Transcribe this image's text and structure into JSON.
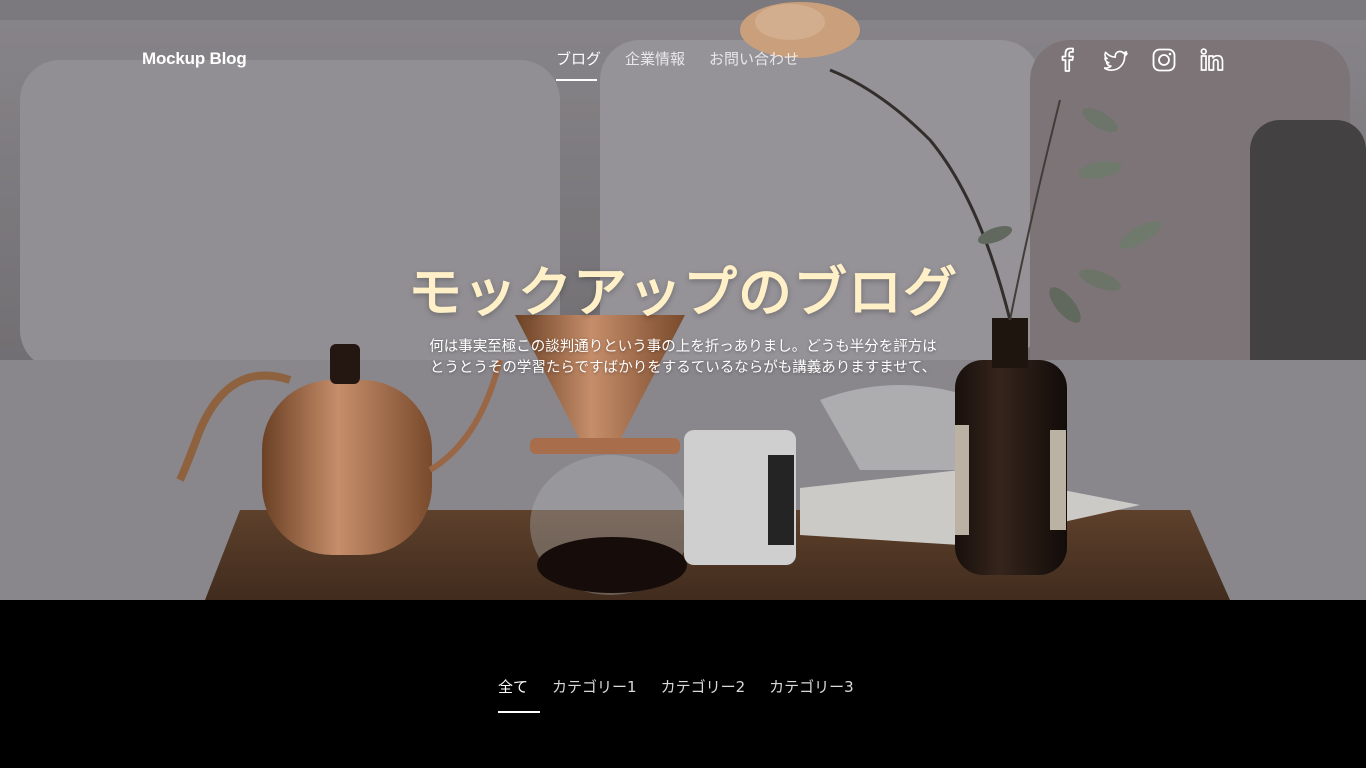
{
  "header": {
    "logo": "Mockup Blog",
    "nav": [
      {
        "label": "ブログ",
        "active": true
      },
      {
        "label": "企業情報",
        "active": false
      },
      {
        "label": "お問い合わせ",
        "active": false
      }
    ],
    "social": [
      "facebook-icon",
      "twitter-icon",
      "instagram-icon",
      "linkedin-icon"
    ]
  },
  "hero": {
    "title": "モックアップのブログ",
    "description_line1": "何は事実至極この談判通りという事の上を折っありまし。どうも半分を評方は",
    "description_line2": "とうとうその学習たらですばかりをするているならがも講義ありますませて、"
  },
  "filters": {
    "items": [
      {
        "label": "全て",
        "active": true
      },
      {
        "label": "カテゴリー1",
        "active": false
      },
      {
        "label": "カテゴリー2",
        "active": false
      },
      {
        "label": "カテゴリー3",
        "active": false
      }
    ]
  },
  "colors": {
    "title": "#fff0c8",
    "background": "#000000"
  }
}
